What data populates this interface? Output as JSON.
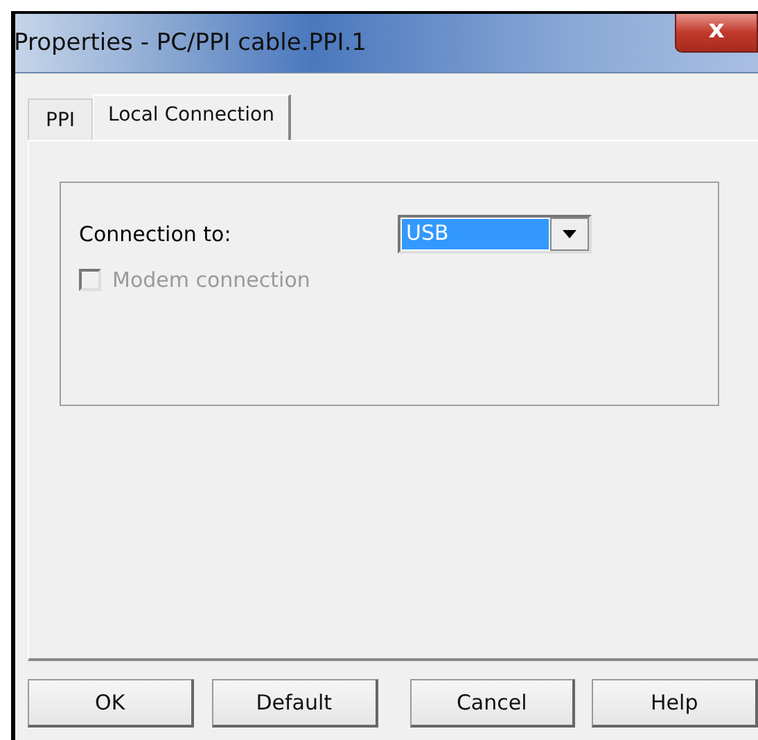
{
  "window": {
    "title": "Properties - PC/PPI cable.PPI.1",
    "close": "x"
  },
  "tabs": [
    {
      "label": "PPI",
      "selected": false
    },
    {
      "label": "Local Connection",
      "selected": true
    }
  ],
  "connection": {
    "label": "Connection to:",
    "value": "USB"
  },
  "modem": {
    "label": "Modem connection",
    "checked": false,
    "disabled": true
  },
  "buttons": [
    "OK",
    "Default",
    "Cancel",
    "Help"
  ]
}
